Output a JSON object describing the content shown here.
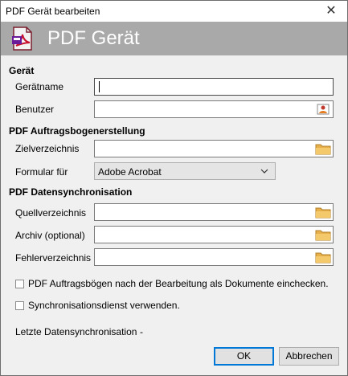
{
  "window": {
    "title": "PDF Gerät bearbeiten",
    "close_glyph": "✕"
  },
  "banner": {
    "title": "PDF Gerät",
    "logo_icon": "pdf-device-icon"
  },
  "sections": {
    "device": "Gerät",
    "form_creation": "PDF Auftragsbogenerstellung",
    "sync": "PDF Datensynchronisation"
  },
  "fields": {
    "device_name": {
      "label": "Gerätname",
      "value": ""
    },
    "user": {
      "label": "Benutzer",
      "value": "",
      "icon": "user-picker-icon"
    },
    "target_dir": {
      "label": "Zielverzeichnis",
      "value": "",
      "icon": "folder-icon"
    },
    "form_for": {
      "label": "Formular für",
      "value": "Adobe Acrobat"
    },
    "source_dir": {
      "label": "Quellverzeichnis",
      "value": "",
      "icon": "folder-icon"
    },
    "archive": {
      "label": "Archiv (optional)",
      "value": "",
      "icon": "folder-icon"
    },
    "error_dir": {
      "label": "Fehlerverzeichnis",
      "value": "",
      "icon": "folder-icon"
    }
  },
  "checkboxes": {
    "checkin": {
      "label": "PDF Auftragsbögen nach der Bearbeitung als Dokumente einchecken.",
      "checked": false
    },
    "sync_service": {
      "label": "Synchronisationsdienst verwenden.",
      "checked": false
    }
  },
  "status": {
    "last_sync_label": "Letzte Datensynchronisation",
    "last_sync_value": "-"
  },
  "buttons": {
    "ok": "OK",
    "cancel": "Abbrechen"
  }
}
